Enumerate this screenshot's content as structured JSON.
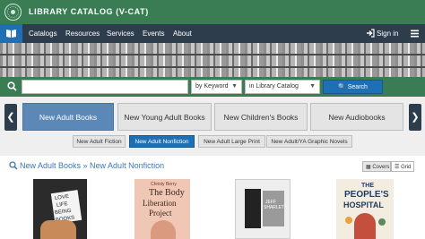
{
  "header": {
    "site_title": "LIBRARY CATALOG (V-CAT)",
    "logo_icon": "library-seal-icon",
    "color": "#3a7d55"
  },
  "nav": {
    "home_icon": "book-icon",
    "items": [
      {
        "label": "Catalogs"
      },
      {
        "label": "Resources"
      },
      {
        "label": "Services"
      },
      {
        "label": "Events"
      },
      {
        "label": "About"
      }
    ],
    "signin_label": "Sign in",
    "signin_icon": "sign-in-icon",
    "menu_icon": "hamburger-menu-icon",
    "color": "#2e3d4c"
  },
  "search": {
    "query": "",
    "type_select": "by Keyword",
    "scope_select": "in Library Catalog",
    "button_label": "Search",
    "search_icon": "search-icon"
  },
  "collections": {
    "tabs": [
      {
        "label": "New Adult Books",
        "active": true
      },
      {
        "label": "New Young Adult Books",
        "active": false
      },
      {
        "label": "New Children's Books",
        "active": false
      },
      {
        "label": "New Audiobooks",
        "active": false
      }
    ],
    "subtabs": [
      {
        "label": "New Adult Fiction",
        "active": false
      },
      {
        "label": "New Adult Nonfiction",
        "active": true
      },
      {
        "label": "New Adult Large Print",
        "active": false
      },
      {
        "label": "New Adult/YA Graphic Novels",
        "active": false
      }
    ],
    "prev_icon": "chevron-left-icon",
    "next_icon": "chevron-right-icon",
    "accent": "#5b88b6"
  },
  "results": {
    "breadcrumb": "New Adult Books » New Adult Nonfiction",
    "view_covers_label": "Covers",
    "view_grid_label": "Grid",
    "books": [
      {
        "cover_text": [
          "LOVE",
          "LIFE",
          "BEING",
          "BOOKS"
        ]
      },
      {
        "cover_text": [
          "Christy Berry",
          "The Body",
          "Liberation",
          "Project"
        ]
      },
      {
        "cover_text": [
          "JEFF",
          "SHARLET"
        ]
      },
      {
        "cover_text": [
          "THE",
          "PEOPLE'S",
          "HOSPITAL"
        ]
      }
    ]
  }
}
